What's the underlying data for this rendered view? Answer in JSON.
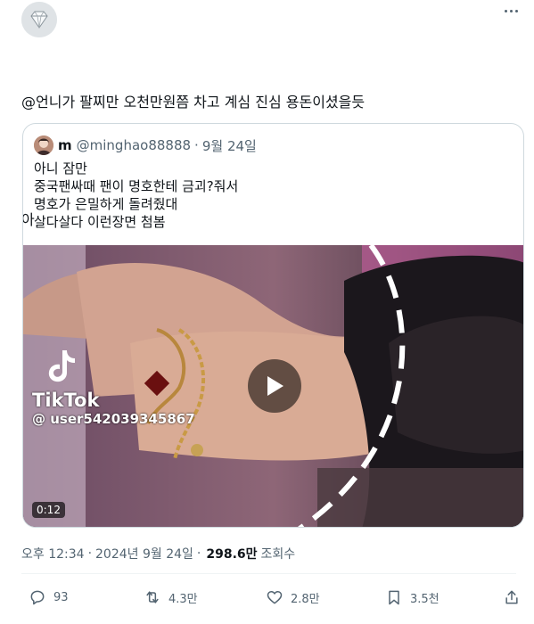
{
  "tweet": {
    "text_lines": [
      "@언니가 팔찌만 오천만원쯤 차고 계심 진심 용돈이셨을듯",
      "",
      "아"
    ]
  },
  "quote": {
    "name": "m",
    "handle": "@minghao88888",
    "dot": "·",
    "date": "9월 24일",
    "body_lines": [
      "아니 잠만",
      "중국팬싸때 팬이 명호한테 금괴?줘서",
      "명호가 은밀하게 돌려줬대",
      "살다살다 이런장면 첨봄"
    ],
    "media": {
      "watermark_brand": "TikTok",
      "watermark_user": "@ user542039345867",
      "duration": "0:12"
    }
  },
  "meta": {
    "time": "오후 12:34",
    "sep": "·",
    "date": "2024년 9월 24일",
    "sep2": "·",
    "views": "298.6만",
    "views_label": "조회수"
  },
  "actions": {
    "reply_count": "93",
    "retweet_count": "4.3만",
    "like_count": "2.8만",
    "bookmark_count": "3.5천"
  },
  "icons": [
    "diamond-avatar-icon",
    "more-icon",
    "play-icon",
    "tiktok-icon",
    "reply-icon",
    "retweet-icon",
    "like-icon",
    "bookmark-icon",
    "share-icon"
  ],
  "colors": {
    "text": "#0f1419",
    "secondary": "#536471",
    "border": "#cfd9de"
  }
}
